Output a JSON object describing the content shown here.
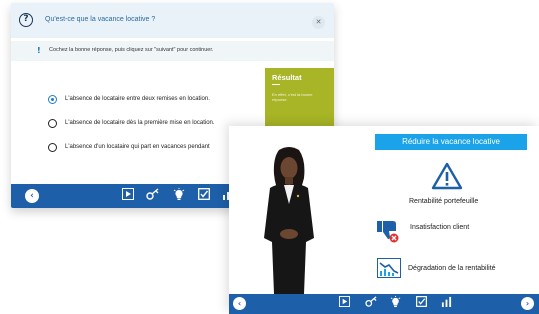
{
  "quiz": {
    "question": "Qu'est-ce que la vacance locative ?",
    "help_icon": "question-circle-icon",
    "close_icon": "close-icon",
    "instruction_mark": "!",
    "instruction": "Cochez la bonne réponse, puis cliquez sur \"suivant\" pour continuer.",
    "options": [
      {
        "label": "L'absence de locataire entre deux remises en location.",
        "selected": true
      },
      {
        "label": "L'absence de locataire dès la première mise en location.",
        "selected": false
      },
      {
        "label": "L'absence d'un locataire qui part en vacances pendant",
        "selected": false
      }
    ],
    "result": {
      "title": "Résultat",
      "text": "En effet, c'est la bonne réponse."
    },
    "nav": {
      "back": "‹",
      "icons": [
        "play-icon",
        "key-icon",
        "lightbulb-icon",
        "checkbox-icon",
        "chart-icon"
      ]
    }
  },
  "video": {
    "banner": "Réduire la vacance locative",
    "items": [
      {
        "icon": "warning-icon",
        "label": "Rentabilité portefeuille"
      },
      {
        "icon": "thumbs-down-icon",
        "label": "Insatisfaction client"
      },
      {
        "icon": "declining-chart-icon",
        "label": "Dégradation de la rentabilité"
      }
    ],
    "nav": {
      "back": "‹",
      "next": "›",
      "icons": [
        "play-icon",
        "key-icon",
        "lightbulb-icon",
        "checkbox-icon",
        "chart-icon"
      ]
    }
  },
  "colors": {
    "nav_blue": "#1d5fa8",
    "banner_blue": "#1aa3e8",
    "result_green": "#a7b526",
    "header_bg": "#e8f2f8"
  }
}
